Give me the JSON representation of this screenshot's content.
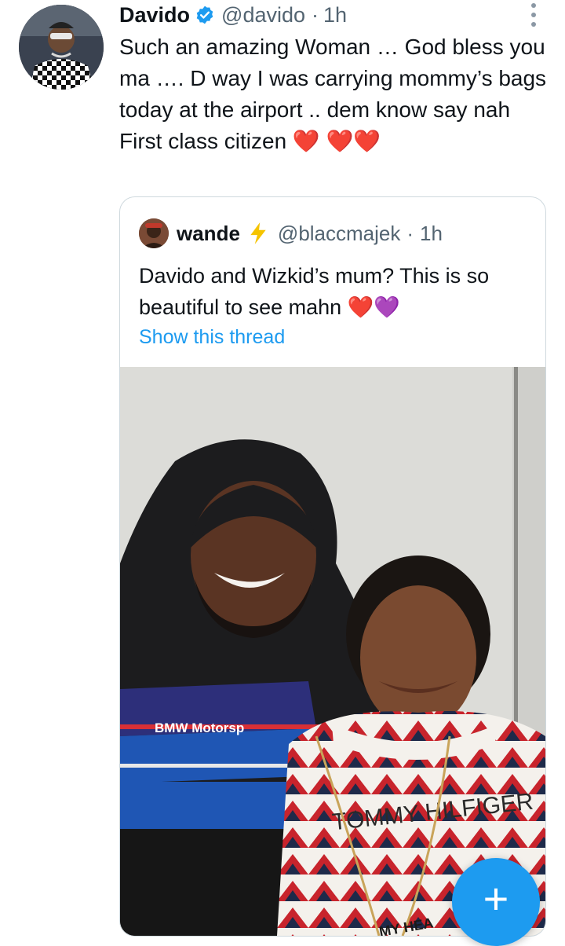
{
  "tweet": {
    "author_name": "Davido",
    "author_handle": "@davido",
    "separator": "·",
    "time": "1h",
    "text": "Such an amazing Woman … God bless you ma …. D way I was carrying mommy’s bags today at the airport .. dem know say nah First class citizen ❤️ ❤️❤️",
    "verified_icon": "verified-badge-icon",
    "more_icon": "more-vertical-icon"
  },
  "quoted_tweet": {
    "author_name": "wande",
    "author_emoji": "⚡",
    "author_handle": "@blaccmajek",
    "separator": "·",
    "time": "1h",
    "text": "Davido and Wizkid’s mum? This is so beautiful to see mahn ❤️💜",
    "show_thread_label": "Show this thread",
    "photo_texts": {
      "jacket_brand": "BMW Motorsp",
      "sweater_brand": "TOMMY HILFIGER",
      "bottom_text": "MY HEA"
    }
  },
  "compose_button": {
    "icon": "plus-icon",
    "label": "+"
  },
  "colors": {
    "accent": "#1d9bf0",
    "secondary_text": "#536471",
    "primary_text": "#0f1419",
    "border": "#cfd9de",
    "bolt": "#f5c400"
  }
}
